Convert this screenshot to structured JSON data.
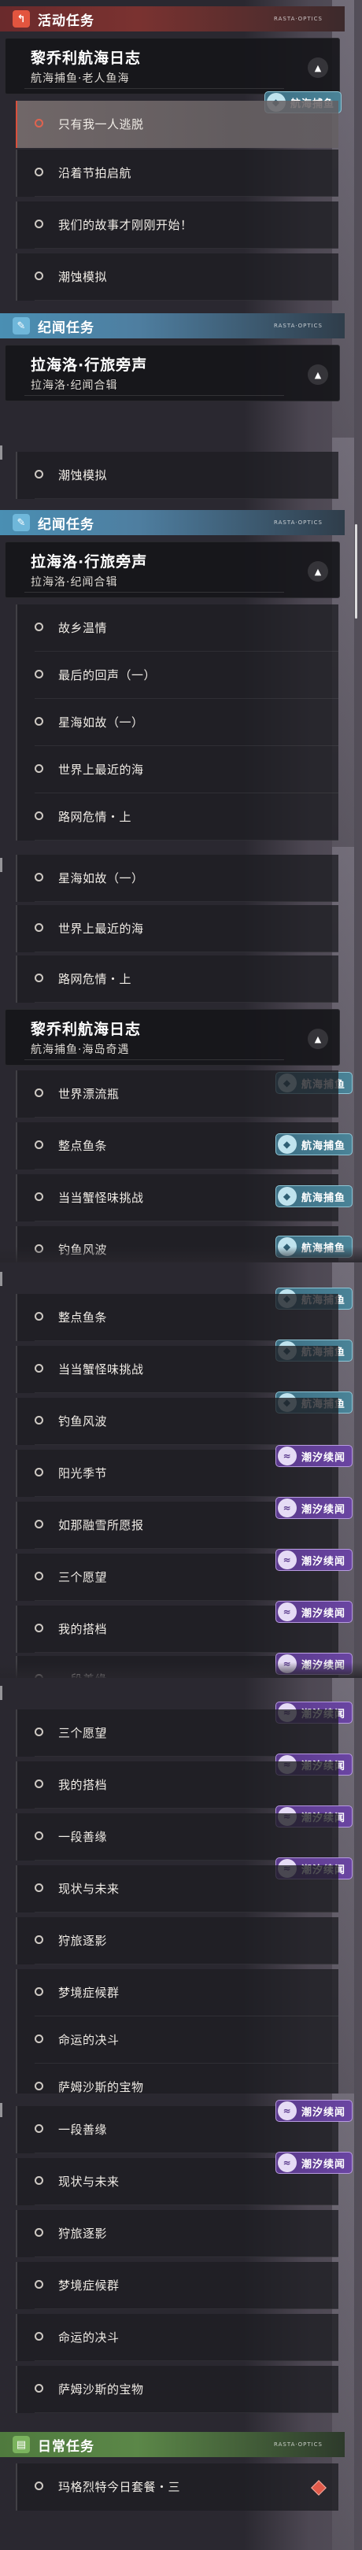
{
  "categories": {
    "activity": "活动任务",
    "chronicle": "纪闻任务",
    "daily": "日常任务"
  },
  "header_deco": "RASTA·OPTICS",
  "chapters": {
    "lechery_log": "黎乔利航海日志",
    "lahailuo": "拉海洛·行旅旁声"
  },
  "subtitles": {
    "old_fisher": "航海捕鱼·老人鱼海",
    "lahailuo_collection": "拉海洛·纪闻合辑",
    "sea_island": "航海捕鱼·海岛奇遇"
  },
  "quests": {
    "only_me_escape": "只有我一人逃脱",
    "along_festival": "沿着节拍启航",
    "our_story": "我们的故事才刚刚开始！",
    "tide_sim": "潮蚀模拟",
    "homesick": "故乡温情",
    "last_echo": "最后的回声（一）",
    "star_sea_1": "星海如故（一）",
    "nearest_sea": "世界上最近的海",
    "route_danger": "路网危情・上",
    "world_bottle": "世界漂流瓶",
    "fish_count": "整点鱼条",
    "monster_fish": "当当蟹怪味挑战",
    "fish_wind": "钓鱼风波",
    "sunny_season": "阳光季节",
    "snow_shelter": "如那融雪所愿报",
    "three_wishes": "三个愿望",
    "my_partner": "我的搭档",
    "one_kindness": "一段善缘",
    "present_future": "现状与未来",
    "hunter_shadow": "狩旅逐影",
    "dream_zone": "梦境症候群",
    "fate_duel": "命运的决斗",
    "sam_treasure": "萨姆沙斯的宝物",
    "gao_daily": "玛格烈特今日套餐・三"
  },
  "badges": {
    "fishing": "航海捕鱼",
    "tide": "潮汐续闻"
  },
  "icons": {
    "activity": "return-arrow-icon",
    "chronicle": "feather-icon",
    "daily": "book-icon",
    "collapse": "chevron-up-icon",
    "bullet": "ring-icon",
    "fish_badge": "fish-icon",
    "tide_badge": "wave-icon",
    "daily_marker": "diamond-icon"
  },
  "colors": {
    "activity_header": "#6a2a2c",
    "chronicle_header": "#4a8fb3",
    "daily_header": "#4f7a3e",
    "selected_accent": "#d94f3c",
    "fish_badge": "#4a8397",
    "tide_badge": "#6a45a2"
  }
}
